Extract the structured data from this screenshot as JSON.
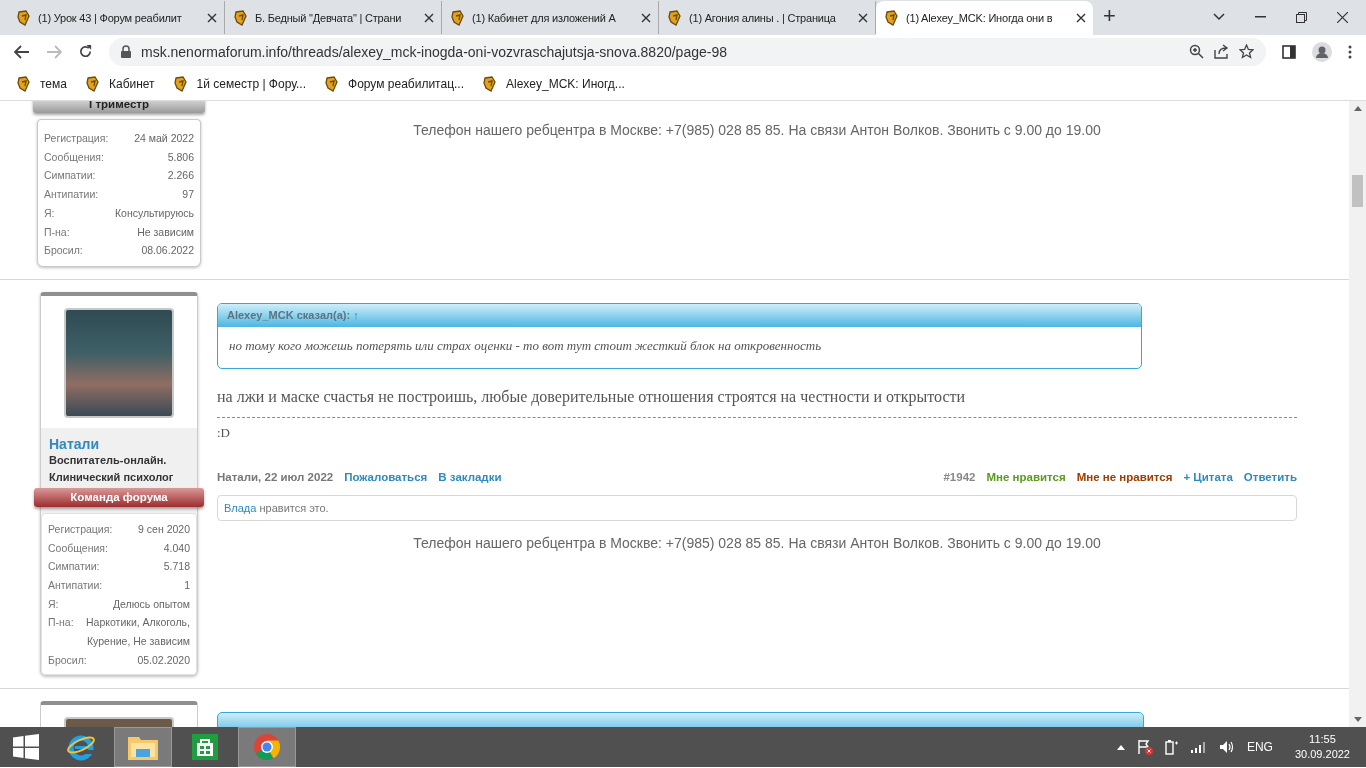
{
  "browser": {
    "tabs": [
      {
        "title": "(1) Урок 43 | Форум реабилит",
        "selected": false
      },
      {
        "title": "Б. Бедный \"Девчата\" | Страни",
        "selected": false
      },
      {
        "title": "(1) Кабинет для изложений А",
        "selected": false
      },
      {
        "title": "(1) Агония алины . | Страница",
        "selected": false
      },
      {
        "title": "(1) Alexey_MCK: Иногда они в",
        "selected": true
      }
    ],
    "new_tab": "+",
    "address": "msk.nenormaforum.info/threads/alexey_mck-inogda-oni-vozvraschajutsja-snova.8820/page-98",
    "bookmarks": [
      "тема",
      "Кабинет",
      "1й семестр | Фору...",
      "Форум реабилитац...",
      "Alexey_MCK: Иногд..."
    ]
  },
  "posts": [
    {
      "banner": {
        "text": "I триместр",
        "kind": "member"
      },
      "stats": [
        {
          "label": "Регистрация:",
          "value": "24 май 2022"
        },
        {
          "label": "Сообщения:",
          "value": "5.806"
        },
        {
          "label": "Симпатии:",
          "value": "2.266"
        },
        {
          "label": "Антипатии:",
          "value": "97"
        },
        {
          "label": "Я:",
          "value": "Консультируюсь"
        },
        {
          "label": "П-на:",
          "value": "Не зависим"
        },
        {
          "label": "Бросил:",
          "value": "08.06.2022"
        }
      ],
      "footer": "Телефон нашего ребцентра в Москве: +7(985) 028 85 85. На связи Антон Волков. Звонить с 9.00 до 19.00"
    },
    {
      "username": "Натали",
      "user_title": "Воспитатель-онлайн. Клинический психолог",
      "banner": {
        "text": "Команда форума",
        "kind": "staff"
      },
      "stats": [
        {
          "label": "Регистрация:",
          "value": "9 сен 2020"
        },
        {
          "label": "Сообщения:",
          "value": "4.040"
        },
        {
          "label": "Симпатии:",
          "value": "5.718"
        },
        {
          "label": "Антипатии:",
          "value": "1"
        },
        {
          "label": "Я:",
          "value": "Делюсь опытом"
        },
        {
          "label": "П-на:",
          "value": "Наркотики, Алкоголь, Курение, Не зависим"
        },
        {
          "label": "Бросил:",
          "value": "05.02.2020"
        }
      ],
      "quote": {
        "author": "Alexey_MCK сказал(а):",
        "arrow": "↑",
        "text": "но тому кого можешь потерять или страх оценки - то вот тут стоит жесткий блок на откровенность"
      },
      "message": "на лжи и маске счастья не построишь, любые доверительные отношения строятся на честности и открытости",
      "signature": ":D",
      "byline": "Натали, 22 июл 2022",
      "actions": [
        "Пожаловаться",
        "В закладки"
      ],
      "number": "#1942",
      "like": "Мне нравится",
      "dislike": "Мне не нравится",
      "quote_link": "+ Цитата",
      "reply": "Ответить",
      "likes": {
        "user": "Влада",
        "text": "нравится это."
      },
      "footer": "Телефон нашего ребцентра в Москве: +7(985) 028 85 85. На связи Антон Волков. Звонить с 9.00 до 19.00"
    }
  ],
  "taskbar": {
    "apps": [
      {
        "kind": "ie",
        "selected": false
      },
      {
        "kind": "explorer",
        "selected": true
      },
      {
        "kind": "store",
        "selected": false
      },
      {
        "kind": "chrome",
        "selected": true
      }
    ],
    "lang": "ENG",
    "time": "11:55",
    "date": "30.09.2022"
  }
}
